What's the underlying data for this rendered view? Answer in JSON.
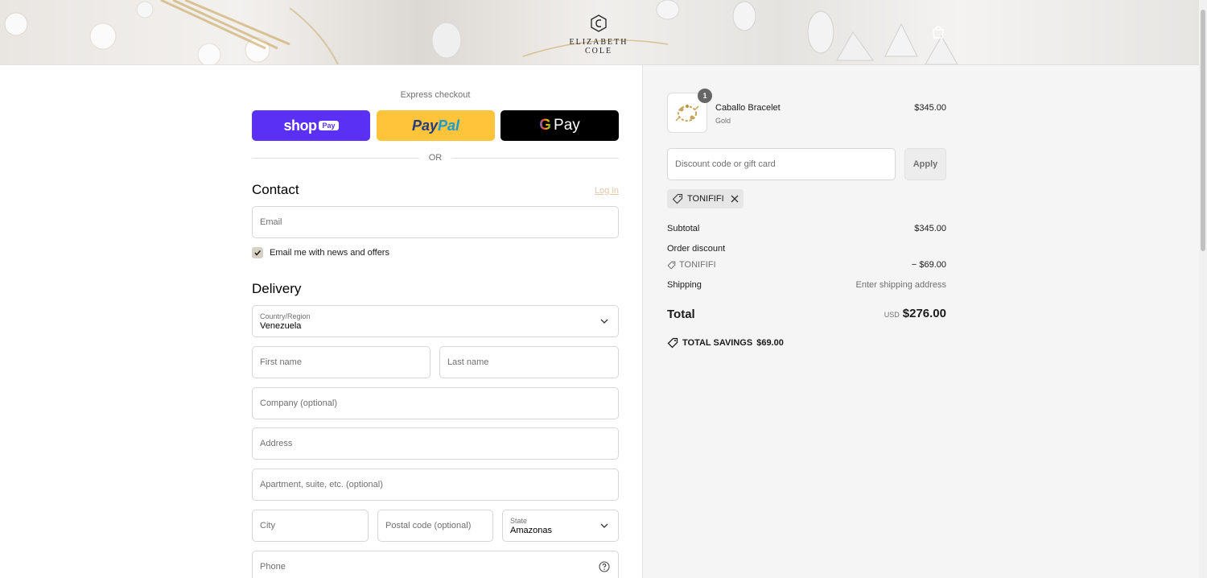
{
  "header": {
    "brand": "ELIZABETH COLE",
    "cart_icon": "shopping-bag-icon"
  },
  "express": {
    "title": "Express checkout",
    "shop_pay": {
      "brand": "shop",
      "badge": "Pay"
    },
    "paypal": {
      "part1": "Pay",
      "part2": "Pal"
    },
    "gpay": {
      "g": "G",
      "label": "Pay"
    },
    "or_label": "OR"
  },
  "contact": {
    "heading": "Contact",
    "login_link": "Log in",
    "email_placeholder": "Email",
    "newsletter_label": "Email me with news and offers",
    "newsletter_checked": true
  },
  "delivery": {
    "heading": "Delivery",
    "country": {
      "label": "Country/Region",
      "value": "Venezuela"
    },
    "first_name_placeholder": "First name",
    "last_name_placeholder": "Last name",
    "company_placeholder": "Company (optional)",
    "address_placeholder": "Address",
    "apartment_placeholder": "Apartment, suite, etc. (optional)",
    "city_placeholder": "City",
    "postal_placeholder": "Postal code (optional)",
    "state": {
      "label": "State",
      "value": "Amazonas"
    },
    "phone_placeholder": "Phone"
  },
  "summary": {
    "item": {
      "quantity": "1",
      "name": "Caballo Bracelet",
      "variant": "Gold",
      "price": "$345.00"
    },
    "discount_placeholder": "Discount code or gift card",
    "apply_label": "Apply",
    "applied_code": "TONIFIFI",
    "subtotal_label": "Subtotal",
    "subtotal_value": "$345.00",
    "order_discount_label": "Order discount",
    "order_discount_code": "TONIFIFI",
    "order_discount_value": "− $69.00",
    "shipping_label": "Shipping",
    "shipping_value": "Enter shipping address",
    "total_label": "Total",
    "total_currency": "USD",
    "total_value": "$276.00",
    "savings_label": "TOTAL SAVINGS",
    "savings_value": "$69.00"
  },
  "colors": {
    "shop_pay": "#5a31f4",
    "paypal": "#ffc439",
    "gpay": "#000000",
    "login_link": "#e1c8ad",
    "checkbox": "#d8cfc5"
  }
}
